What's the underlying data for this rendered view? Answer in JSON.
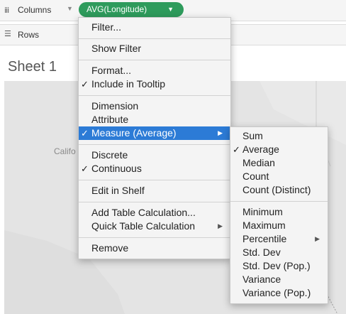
{
  "shelves": {
    "columns_label": "Columns",
    "rows_label": "Rows",
    "pill_label": "AVG(Longitude)"
  },
  "sheet": {
    "title": "Sheet 1",
    "map_label": "Califo"
  },
  "context_menu": {
    "filter": "Filter...",
    "show_filter": "Show Filter",
    "format": "Format...",
    "include_tooltip": "Include in Tooltip",
    "dimension": "Dimension",
    "attribute": "Attribute",
    "measure": "Measure (Average)",
    "discrete": "Discrete",
    "continuous": "Continuous",
    "edit_in_shelf": "Edit in Shelf",
    "add_table_calc": "Add Table Calculation...",
    "quick_table_calc": "Quick Table Calculation",
    "remove": "Remove"
  },
  "measure_submenu": {
    "sum": "Sum",
    "average": "Average",
    "median": "Median",
    "count": "Count",
    "count_distinct": "Count (Distinct)",
    "minimum": "Minimum",
    "maximum": "Maximum",
    "percentile": "Percentile",
    "std_dev": "Std. Dev",
    "std_dev_pop": "Std. Dev (Pop.)",
    "variance": "Variance",
    "variance_pop": "Variance (Pop.)"
  },
  "glyphs": {
    "check": "✓",
    "arrow": "▶",
    "caret": "▼",
    "shelf_icon": "iii",
    "rows_icon": "☰"
  },
  "colors": {
    "pill": "#2e9b5c",
    "highlight": "#2c7bd6"
  }
}
